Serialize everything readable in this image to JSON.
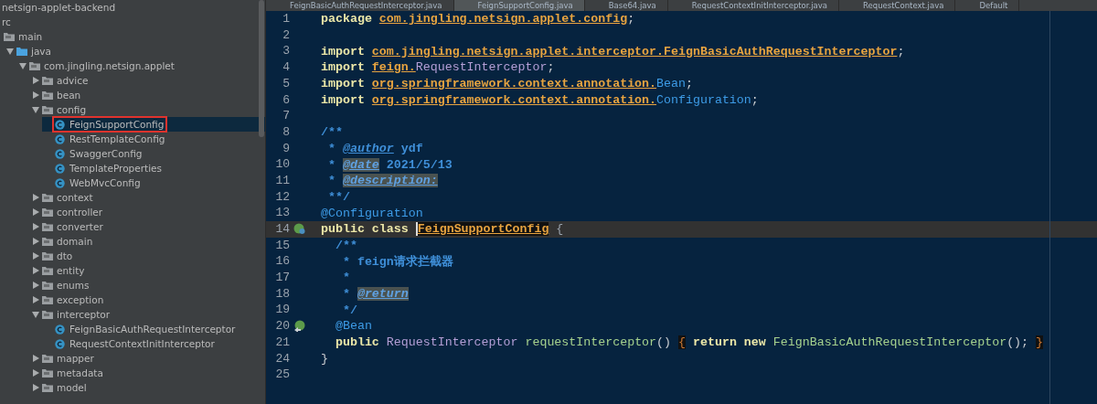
{
  "project_tree": {
    "items": [
      {
        "label": "netsign-applet-backend",
        "kind": "label",
        "selected": false,
        "children": [
          {
            "label": "rc",
            "kind": "label",
            "selected": false,
            "children": [
              {
                "label": "main",
                "kind": "folder",
                "selected": false,
                "children": [
                  {
                    "label": "java",
                    "kind": "source-folder",
                    "expanded": true,
                    "selected": false,
                    "children": [
                      {
                        "label": "com.jingling.netsign.applet",
                        "kind": "folder",
                        "expanded": true,
                        "selected": false,
                        "children": [
                          {
                            "label": "advice",
                            "kind": "folder",
                            "expanded": false,
                            "selected": false
                          },
                          {
                            "label": "bean",
                            "kind": "folder",
                            "expanded": false,
                            "selected": false
                          },
                          {
                            "label": "config",
                            "kind": "folder",
                            "expanded": true,
                            "selected": false,
                            "children": [
                              {
                                "label": "FeignSupportConfig",
                                "kind": "class",
                                "selected": true
                              },
                              {
                                "label": "RestTemplateConfig",
                                "kind": "class",
                                "selected": false
                              },
                              {
                                "label": "SwaggerConfig",
                                "kind": "class",
                                "selected": false
                              },
                              {
                                "label": "TemplateProperties",
                                "kind": "class",
                                "selected": false
                              },
                              {
                                "label": "WebMvcConfig",
                                "kind": "class",
                                "selected": false
                              }
                            ]
                          },
                          {
                            "label": "context",
                            "kind": "folder",
                            "expanded": false,
                            "selected": false
                          },
                          {
                            "label": "controller",
                            "kind": "folder",
                            "expanded": false,
                            "selected": false
                          },
                          {
                            "label": "converter",
                            "kind": "folder",
                            "expanded": false,
                            "selected": false
                          },
                          {
                            "label": "domain",
                            "kind": "folder",
                            "expanded": false,
                            "selected": false
                          },
                          {
                            "label": "dto",
                            "kind": "folder",
                            "expanded": false,
                            "selected": false
                          },
                          {
                            "label": "entity",
                            "kind": "folder",
                            "expanded": false,
                            "selected": false
                          },
                          {
                            "label": "enums",
                            "kind": "folder",
                            "expanded": false,
                            "selected": false
                          },
                          {
                            "label": "exception",
                            "kind": "folder",
                            "expanded": false,
                            "selected": false
                          },
                          {
                            "label": "interceptor",
                            "kind": "folder",
                            "expanded": true,
                            "selected": false,
                            "children": [
                              {
                                "label": "FeignBasicAuthRequestInterceptor",
                                "kind": "class",
                                "selected": false
                              },
                              {
                                "label": "RequestContextInitInterceptor",
                                "kind": "class",
                                "selected": false
                              }
                            ]
                          },
                          {
                            "label": "mapper",
                            "kind": "folder",
                            "expanded": false,
                            "selected": false
                          },
                          {
                            "label": "metadata",
                            "kind": "folder",
                            "expanded": false,
                            "selected": false
                          },
                          {
                            "label": "model",
                            "kind": "folder",
                            "expanded": false,
                            "selected": false
                          }
                        ]
                      }
                    ]
                  }
                ]
              }
            ]
          }
        ]
      }
    ]
  },
  "editor_tabs": [
    {
      "label": "FeignBasicAuthRequestInterceptor.java",
      "selected": false
    },
    {
      "label": "FeignSupportConfig.java",
      "selected": true
    },
    {
      "label": "Base64.java",
      "selected": false
    },
    {
      "label": "RequestContextInitInterceptor.java",
      "selected": false
    },
    {
      "label": "RequestContext.java",
      "selected": false
    },
    {
      "label": "Default",
      "selected": false
    }
  ],
  "code_lines": [
    {
      "number": "1",
      "current": false,
      "tokens": [
        {
          "text": "package ",
          "kind": "kw"
        },
        {
          "text": "com.jingling.netsign.applet.config",
          "kind": "pkg"
        },
        {
          "text": ";",
          "kind": "plain"
        }
      ]
    },
    {
      "number": "2",
      "current": false,
      "kind": "plain"
    },
    {
      "number": "3",
      "current": false,
      "tokens": [
        {
          "text": "import ",
          "kind": "kw"
        },
        {
          "text": "com.jingling.netsign.applet.interceptor.FeignBasicAuthRequestInterceptor",
          "kind": "pkg"
        },
        {
          "text": ";",
          "kind": "plain"
        }
      ]
    },
    {
      "number": "4",
      "current": false,
      "tokens": [
        {
          "text": "import ",
          "kind": "kw"
        },
        {
          "text": "feign.",
          "kind": "pkg"
        },
        {
          "text": "RequestInterceptor",
          "kind": "type"
        },
        {
          "text": ";",
          "kind": "plain"
        }
      ]
    },
    {
      "number": "5",
      "current": false,
      "tokens": [
        {
          "text": "import ",
          "kind": "kw"
        },
        {
          "text": "org.springframework.context.annotation.",
          "kind": "pkg"
        },
        {
          "text": "Bean",
          "kind": "ann"
        },
        {
          "text": ";",
          "kind": "plain"
        }
      ]
    },
    {
      "number": "6",
      "current": false,
      "tokens": [
        {
          "text": "import ",
          "kind": "kw"
        },
        {
          "text": "org.springframework.context.annotation.",
          "kind": "pkg"
        },
        {
          "text": "Configuration",
          "kind": "ann"
        },
        {
          "text": ";",
          "kind": "plain"
        }
      ]
    },
    {
      "number": "7",
      "current": false,
      "kind": "plain"
    },
    {
      "number": "8",
      "current": false,
      "tokens": [
        {
          "text": "/**",
          "kind": "doc"
        }
      ]
    },
    {
      "number": "9",
      "current": false,
      "tokens": [
        {
          "text": " * ",
          "kind": "doc"
        },
        {
          "text": "@author",
          "kind": "doctag",
          "highlighted": false
        },
        {
          "text": " ydf",
          "kind": "doc"
        }
      ]
    },
    {
      "number": "10",
      "current": false,
      "tokens": [
        {
          "text": " * ",
          "kind": "doc"
        },
        {
          "text": "@date",
          "kind": "doctag",
          "highlighted": true
        },
        {
          "text": " 2021/5/13",
          "kind": "doc"
        }
      ]
    },
    {
      "number": "11",
      "current": false,
      "tokens": [
        {
          "text": " * ",
          "kind": "doc"
        },
        {
          "text": "@description:",
          "kind": "doctag",
          "highlighted": true
        }
      ]
    },
    {
      "number": "12",
      "current": false,
      "tokens": [
        {
          "text": " **/",
          "kind": "doc"
        }
      ]
    },
    {
      "number": "13",
      "current": false,
      "tokens": [
        {
          "text": "@Configuration",
          "kind": "ann"
        }
      ]
    },
    {
      "number": "14",
      "current": true,
      "kind": "bean-class",
      "tokens": [
        {
          "text": "public class ",
          "kind": "kw"
        },
        {
          "text": "FeignSupportConfig",
          "kind": "decl",
          "highlighted": true
        },
        {
          "text": " {",
          "kind": "brace"
        }
      ]
    },
    {
      "number": "15",
      "current": false,
      "tokens": [
        {
          "text": "  /**",
          "kind": "doc"
        }
      ]
    },
    {
      "number": "16",
      "current": false,
      "tokens": [
        {
          "text": "   * feign请求拦截器",
          "kind": "doc"
        }
      ]
    },
    {
      "number": "17",
      "current": false,
      "tokens": [
        {
          "text": "   *",
          "kind": "doc"
        }
      ]
    },
    {
      "number": "18",
      "current": false,
      "tokens": [
        {
          "text": "   * ",
          "kind": "doc"
        },
        {
          "text": "@return",
          "kind": "doctag",
          "highlighted": true
        }
      ]
    },
    {
      "number": "19",
      "current": false,
      "tokens": [
        {
          "text": "   */",
          "kind": "doc"
        }
      ]
    },
    {
      "number": "20",
      "current": false,
      "kind": "bean-method",
      "tokens": [
        {
          "text": "  @Bean",
          "kind": "ann"
        }
      ]
    },
    {
      "number": "21",
      "current": false,
      "tokens": [
        {
          "text": "  public ",
          "kind": "kw"
        },
        {
          "text": "RequestInterceptor ",
          "kind": "type"
        },
        {
          "text": "requestInterceptor",
          "kind": "method"
        },
        {
          "text": "() ",
          "kind": "plain"
        },
        {
          "text": "{",
          "kind": "fold",
          "highlighted": true
        },
        {
          "text": " return new ",
          "kind": "kw"
        },
        {
          "text": "FeignBasicAuthRequestInterceptor",
          "kind": "method"
        },
        {
          "text": "(); ",
          "kind": "plain"
        },
        {
          "text": "}",
          "kind": "fold",
          "highlighted": true
        }
      ]
    },
    {
      "number": "24",
      "current": false,
      "tokens": [
        {
          "text": "}",
          "kind": "plain"
        }
      ]
    },
    {
      "number": "25",
      "current": false,
      "kind": "plain"
    }
  ]
}
